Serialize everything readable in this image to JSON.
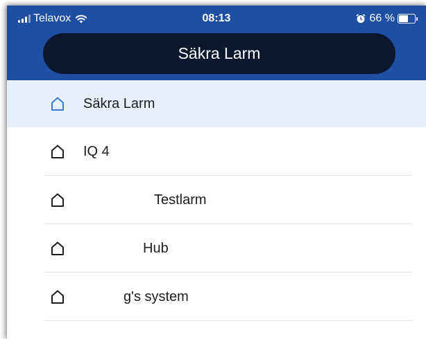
{
  "status_bar": {
    "carrier": "Telavox",
    "time": "08:13",
    "battery_percent_text": "66 %",
    "battery_level": 0.66,
    "icons": [
      "signal-icon",
      "wifi-icon",
      "alarm-icon",
      "battery-icon"
    ]
  },
  "header": {
    "title": "Säkra Larm"
  },
  "colors": {
    "header_bg": "#1f4fa3",
    "title_pill_bg": "#0d1730",
    "selected_row_bg": "#e7effa",
    "selected_icon": "#3a7bd5"
  },
  "systems": [
    {
      "label": "Säkra Larm",
      "selected": true,
      "icon": "home-icon"
    },
    {
      "label": "IQ 4",
      "selected": false,
      "icon": "home-icon"
    },
    {
      "label": "Testlarm",
      "selected": false,
      "icon": "home-icon"
    },
    {
      "label": "Hub",
      "selected": false,
      "icon": "home-icon"
    },
    {
      "label": "g's system",
      "selected": false,
      "icon": "home-icon"
    }
  ]
}
